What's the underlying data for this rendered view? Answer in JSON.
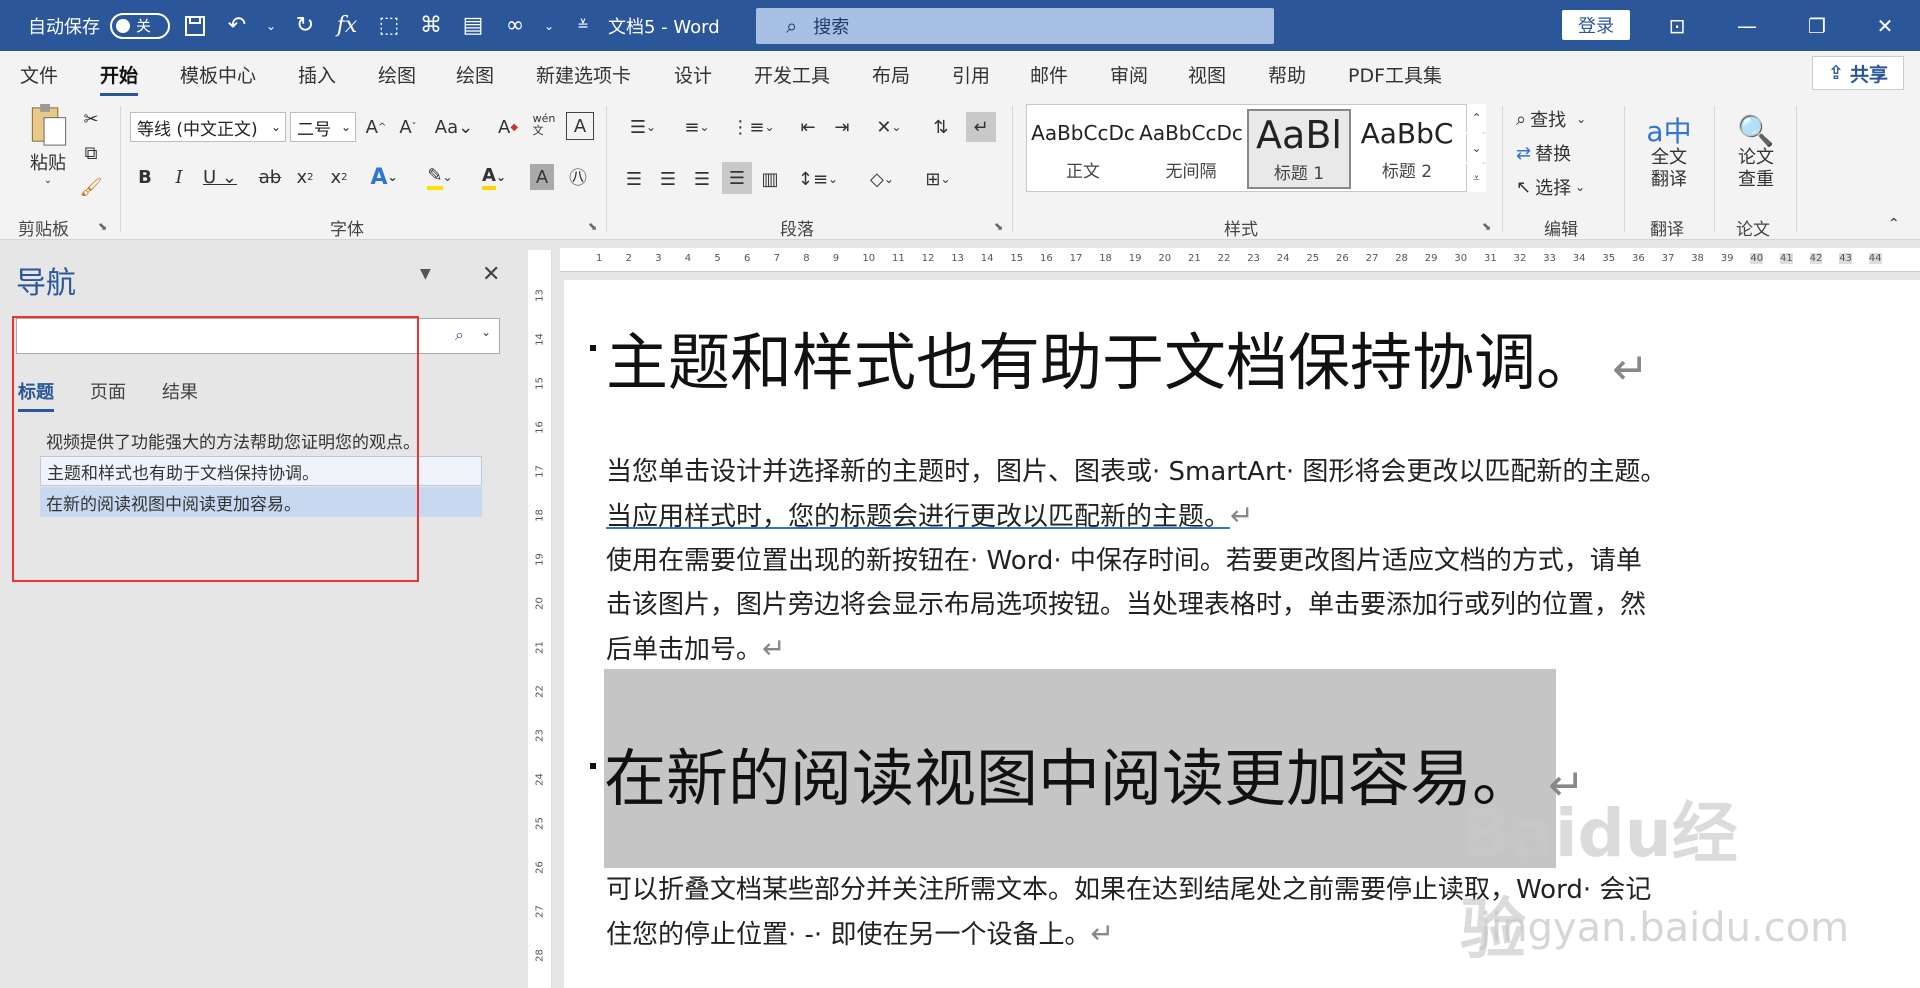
{
  "titlebar": {
    "autosave_label": "自动保存",
    "autosave_state": "关",
    "doc_title": "文档5 - Word",
    "search_placeholder": "搜索",
    "login_label": "登录"
  },
  "tabs": [
    "文件",
    "开始",
    "模板中心",
    "插入",
    "绘图",
    "绘图",
    "新建选项卡",
    "设计",
    "开发工具",
    "布局",
    "引用",
    "邮件",
    "审阅",
    "视图",
    "帮助",
    "PDF工具集"
  ],
  "active_tab": "开始",
  "share_label": "共享",
  "ribbon": {
    "clipboard": {
      "paste_label": "粘贴",
      "group_label": "剪贴板"
    },
    "font": {
      "font_name": "等线 (中文正文)",
      "font_size": "二号",
      "group_label": "字体"
    },
    "paragraph": {
      "group_label": "段落"
    },
    "styles": {
      "group_label": "样式",
      "items": [
        {
          "sample": "AaBbCcDc",
          "name": "正文"
        },
        {
          "sample": "AaBbCcDc",
          "name": "无间隔"
        },
        {
          "sample": "AaBl",
          "name": "标题 1"
        },
        {
          "sample": "AaBbC",
          "name": "标题 2"
        }
      ]
    },
    "editing": {
      "find": "查找",
      "replace": "替换",
      "select": "选择",
      "group_label": "编辑"
    },
    "translate": {
      "label": "全文\n翻译",
      "line1": "全文",
      "line2": "翻译",
      "group_label": "翻译"
    },
    "thesis": {
      "line1": "论文",
      "line2": "查重",
      "group_label": "论文"
    }
  },
  "nav": {
    "title": "导航",
    "tabs": [
      "标题",
      "页面",
      "结果"
    ],
    "headings": [
      "视频提供了功能强大的方法帮助您证明您的观点。",
      "主题和样式也有助于文档保持协调。",
      "在新的阅读视图中阅读更加容易。"
    ]
  },
  "ruler": {
    "h": [
      "1",
      "2",
      "3",
      "4",
      "5",
      "6",
      "7",
      "8",
      "9",
      "10",
      "11",
      "12",
      "13",
      "14",
      "15",
      "16",
      "17",
      "18",
      "19",
      "20",
      "21",
      "22",
      "23",
      "24",
      "25",
      "26",
      "27",
      "28",
      "29",
      "30",
      "31",
      "32",
      "33",
      "34",
      "35",
      "36",
      "37",
      "38",
      "39",
      "40",
      "41",
      "42",
      "43",
      "44"
    ],
    "v": [
      "13",
      "14",
      "15",
      "16",
      "17",
      "18",
      "19",
      "20",
      "21",
      "22",
      "23",
      "24",
      "25",
      "26",
      "27",
      "28"
    ]
  },
  "document": {
    "heading1": "主题和样式也有助于文档保持协调。",
    "para1_line1": "当您单击设计并选择新的主题时，图片、图表或· SmartArt· 图形将会更改以匹配新的主题。",
    "para1_line2": "当应用样式时，您的标题会进行更改以匹配新的主题。",
    "para2_line1": "使用在需要位置出现的新按钮在· Word· 中保存时间。若要更改图片适应文档的方式，请单",
    "para2_line2": "击该图片，图片旁边将会显示布局选项按钮。当处理表格时，单击要添加行或列的位置，然",
    "para2_line3": "后单击加号。",
    "heading2": "在新的阅读视图中阅读更加容易。",
    "para3_line1": "可以折叠文档某些部分并关注所需文本。如果在达到结尾处之前需要停止读取，Word· 会记",
    "para3_line2": "住您的停止位置· -· 即使在另一个设备上。",
    "return_mark": "↵"
  },
  "watermark": {
    "brand": "Baidu经验",
    "url": "jingyan.baidu.com"
  }
}
